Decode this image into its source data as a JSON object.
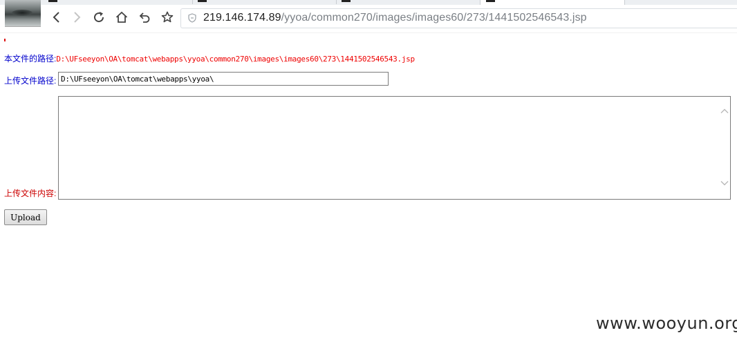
{
  "browser": {
    "url_host": "219.146.174.89",
    "url_path": "/yyoa/common270/images/images60/273/1441502546543.jsp"
  },
  "page": {
    "file_path_label": "本文件的路径:",
    "file_path_value": "D:\\UFseeyon\\OA\\tomcat\\webapps\\yyoa\\common270\\images\\images60\\273\\1441502546543.jsp",
    "upload_path_label": "上传文件路径:",
    "upload_path_value": "D:\\UFseeyon\\OA\\tomcat\\webapps\\yyoa\\",
    "upload_content_label": "上传文件内容:",
    "upload_content_value": "",
    "upload_button_label": "Upload"
  },
  "watermark": "www.wooyun.org",
  "colors": {
    "label_blue": "#0000cc",
    "path_red": "#ee0000",
    "content_label_red": "#cc0000"
  }
}
